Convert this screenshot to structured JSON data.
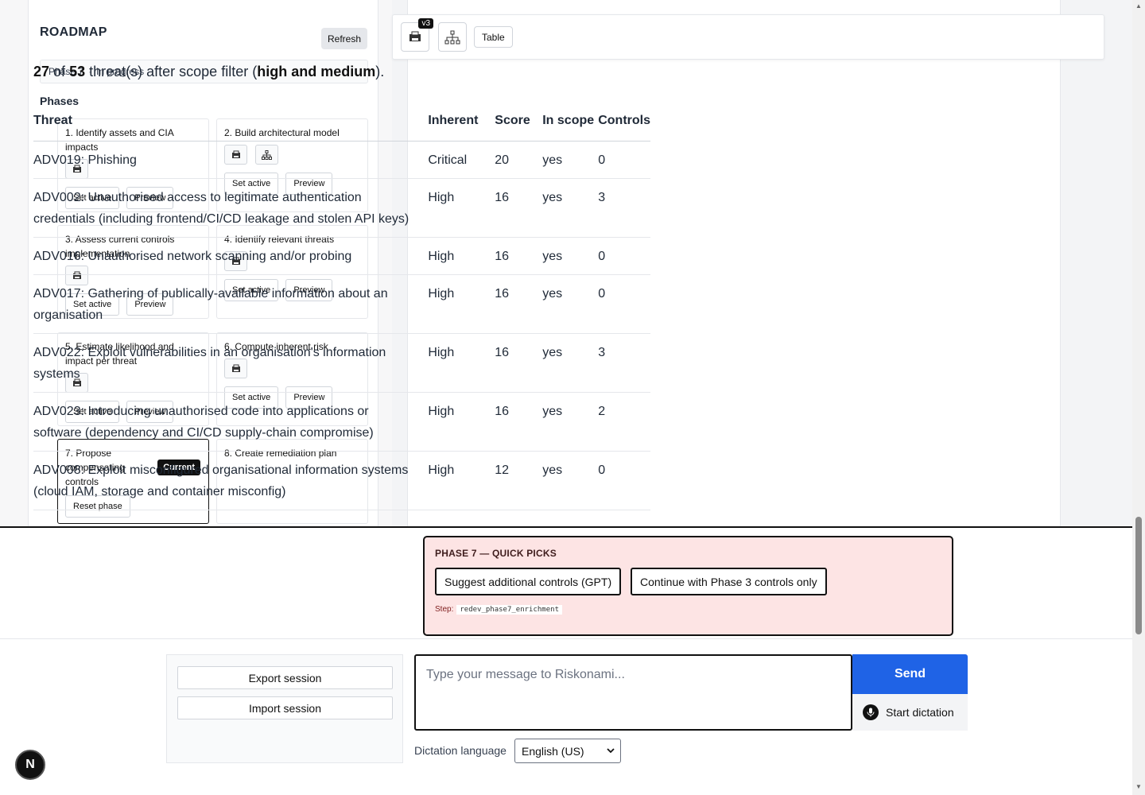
{
  "roadmap": {
    "title": "ROADMAP",
    "refresh_label": "Refresh",
    "status_phase": "Phase 7",
    "status_dot": "·",
    "status_state": "In progress",
    "phases_label": "Phases",
    "set_active_label": "Set active",
    "preview_label": "Preview",
    "reset_label": "Reset phase",
    "current_label": "Current",
    "phases": [
      {
        "title": "1. Identify assets and CIA impacts"
      },
      {
        "title": "2. Build architectural model"
      },
      {
        "title": "3. Assess current controls implementation"
      },
      {
        "title": "4. Identify relevant threats"
      },
      {
        "title": "5. Estimate likelihood and impact per threat"
      },
      {
        "title": "6. Compute inherent risk"
      },
      {
        "title": "7. Propose compensating controls"
      },
      {
        "title": "8. Create remediation plan"
      }
    ]
  },
  "toolbar": {
    "version_badge": "v3",
    "table_label": "Table"
  },
  "summary": {
    "count": "27",
    "of": "of",
    "total": "53",
    "text": "threat(s) after scope filter (",
    "scope": "high and medium",
    "end": ")."
  },
  "table": {
    "headers": {
      "threat": "Threat",
      "inherent": "Inherent",
      "score": "Score",
      "in_scope": "In scope",
      "controls": "Controls"
    },
    "rows": [
      {
        "threat": "ADV019: Phishing",
        "inherent": "Critical",
        "score": "20",
        "in_scope": "yes",
        "controls": "0"
      },
      {
        "threat": "ADV002: Unauthorised access to legitimate authentication credentials (including frontend/CI/CD leakage and stolen API keys)",
        "inherent": "High",
        "score": "16",
        "in_scope": "yes",
        "controls": "3"
      },
      {
        "threat": "ADV016: Unauthorised network scanning and/or probing",
        "inherent": "High",
        "score": "16",
        "in_scope": "yes",
        "controls": "0"
      },
      {
        "threat": "ADV017: Gathering of publically-available information about an organisation",
        "inherent": "High",
        "score": "16",
        "in_scope": "yes",
        "controls": "0"
      },
      {
        "threat": "ADV022: Exploit vulnerabilities in an organisation's information systems",
        "inherent": "High",
        "score": "16",
        "in_scope": "yes",
        "controls": "3"
      },
      {
        "threat": "ADV023: Introducing unauthorised code into applications or software (dependency and CI/CD supply-chain compromise)",
        "inherent": "High",
        "score": "16",
        "in_scope": "yes",
        "controls": "2"
      },
      {
        "threat": "ADV008: Exploit misconfigured organisational information systems (cloud IAM, storage and container misconfig)",
        "inherent": "High",
        "score": "12",
        "in_scope": "yes",
        "controls": "0"
      }
    ]
  },
  "quick_picks": {
    "title": "PHASE 7 — QUICK PICKS",
    "option1": "Suggest additional controls (GPT)",
    "option2": "Continue with Phase 3 controls only",
    "step_label": "Step:",
    "step_value": "redev_phase7_enrichment"
  },
  "session": {
    "export_label": "Export session",
    "import_label": "Import session"
  },
  "composer": {
    "placeholder": "Type your message to Riskonami...",
    "send_label": "Send",
    "dictation_label": "Start dictation",
    "language_label": "Dictation language",
    "language_value": "English (US)"
  },
  "footer": {
    "n_badge": "N"
  },
  "colors": {
    "primary": "#1f63e6",
    "quick_bg": "#fde4e4",
    "dark": "#111111"
  }
}
